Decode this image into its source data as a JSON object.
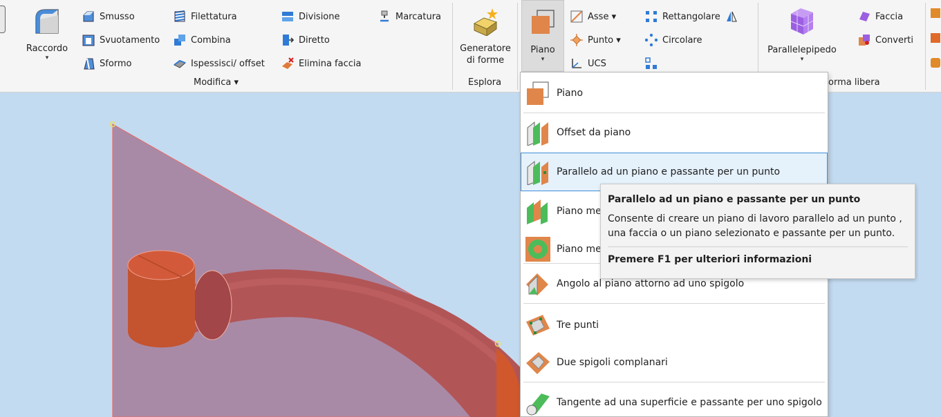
{
  "ribbon": {
    "raccordo": {
      "label": "Raccordo",
      "icon": "fillet-icon"
    },
    "modifica": {
      "items": {
        "smusso": "Smusso",
        "svuotamento": "Svuotamento",
        "sformo": "Sformo",
        "filettatura": "Filettatura",
        "combina": "Combina",
        "ispessisci": "Ispessisci/ offset",
        "divisione": "Divisione",
        "diretto": "Diretto",
        "elimina_faccia": "Elimina faccia",
        "marcatura": "Marcatura"
      },
      "panel_label": "Modifica ▾"
    },
    "esplora": {
      "generatore_line1": "Generatore",
      "generatore_line2": "di forme",
      "panel_label": "Esplora"
    },
    "lavoro": {
      "piano": "Piano",
      "asse": "Asse ▾",
      "punto": "Punto ▾",
      "ucs": "UCS",
      "rettangolare": "Rettangolare",
      "circolare": "Circolare"
    },
    "forma_libera": {
      "parallelepipedo": "Parallelepipedo",
      "faccia": "Faccia",
      "converti": "Converti",
      "panel_label": "orma libera"
    }
  },
  "plane_menu": {
    "items": [
      {
        "label": "Piano",
        "icon": "plane-icon"
      },
      {
        "label": "Offset da piano",
        "icon": "offset-plane-icon"
      },
      {
        "label": "Parallelo ad un piano e passante per un punto",
        "icon": "parallel-plane-point-icon",
        "highlighted": true
      },
      {
        "label": "Piano me",
        "icon": "midplane-icon"
      },
      {
        "label": "Piano me",
        "icon": "midplane-torus-icon"
      },
      {
        "label": "Angolo al piano attorno ad uno spigolo",
        "icon": "angle-plane-edge-icon"
      },
      {
        "label": "Tre punti",
        "icon": "three-points-icon"
      },
      {
        "label": "Due spigoli complanari",
        "icon": "two-edges-icon"
      },
      {
        "label": "Tangente ad una superficie e passante per uno spigolo",
        "icon": "tangent-surface-edge-icon"
      }
    ]
  },
  "tooltip": {
    "title": "Parallelo ad un piano e passante per un punto",
    "body": "Consente di creare un piano di lavoro parallelo ad un punto , una faccia o un piano selezionato e passante per un punto.",
    "help": "Premere F1 per ulteriori informazioni"
  },
  "colors": {
    "viewport_bg": "#c3dbf1",
    "work_plane": "#a98aa6",
    "pipe": "#b25556",
    "highlight_bg": "#e5f1fb",
    "highlight_border": "#3e8ed8"
  }
}
